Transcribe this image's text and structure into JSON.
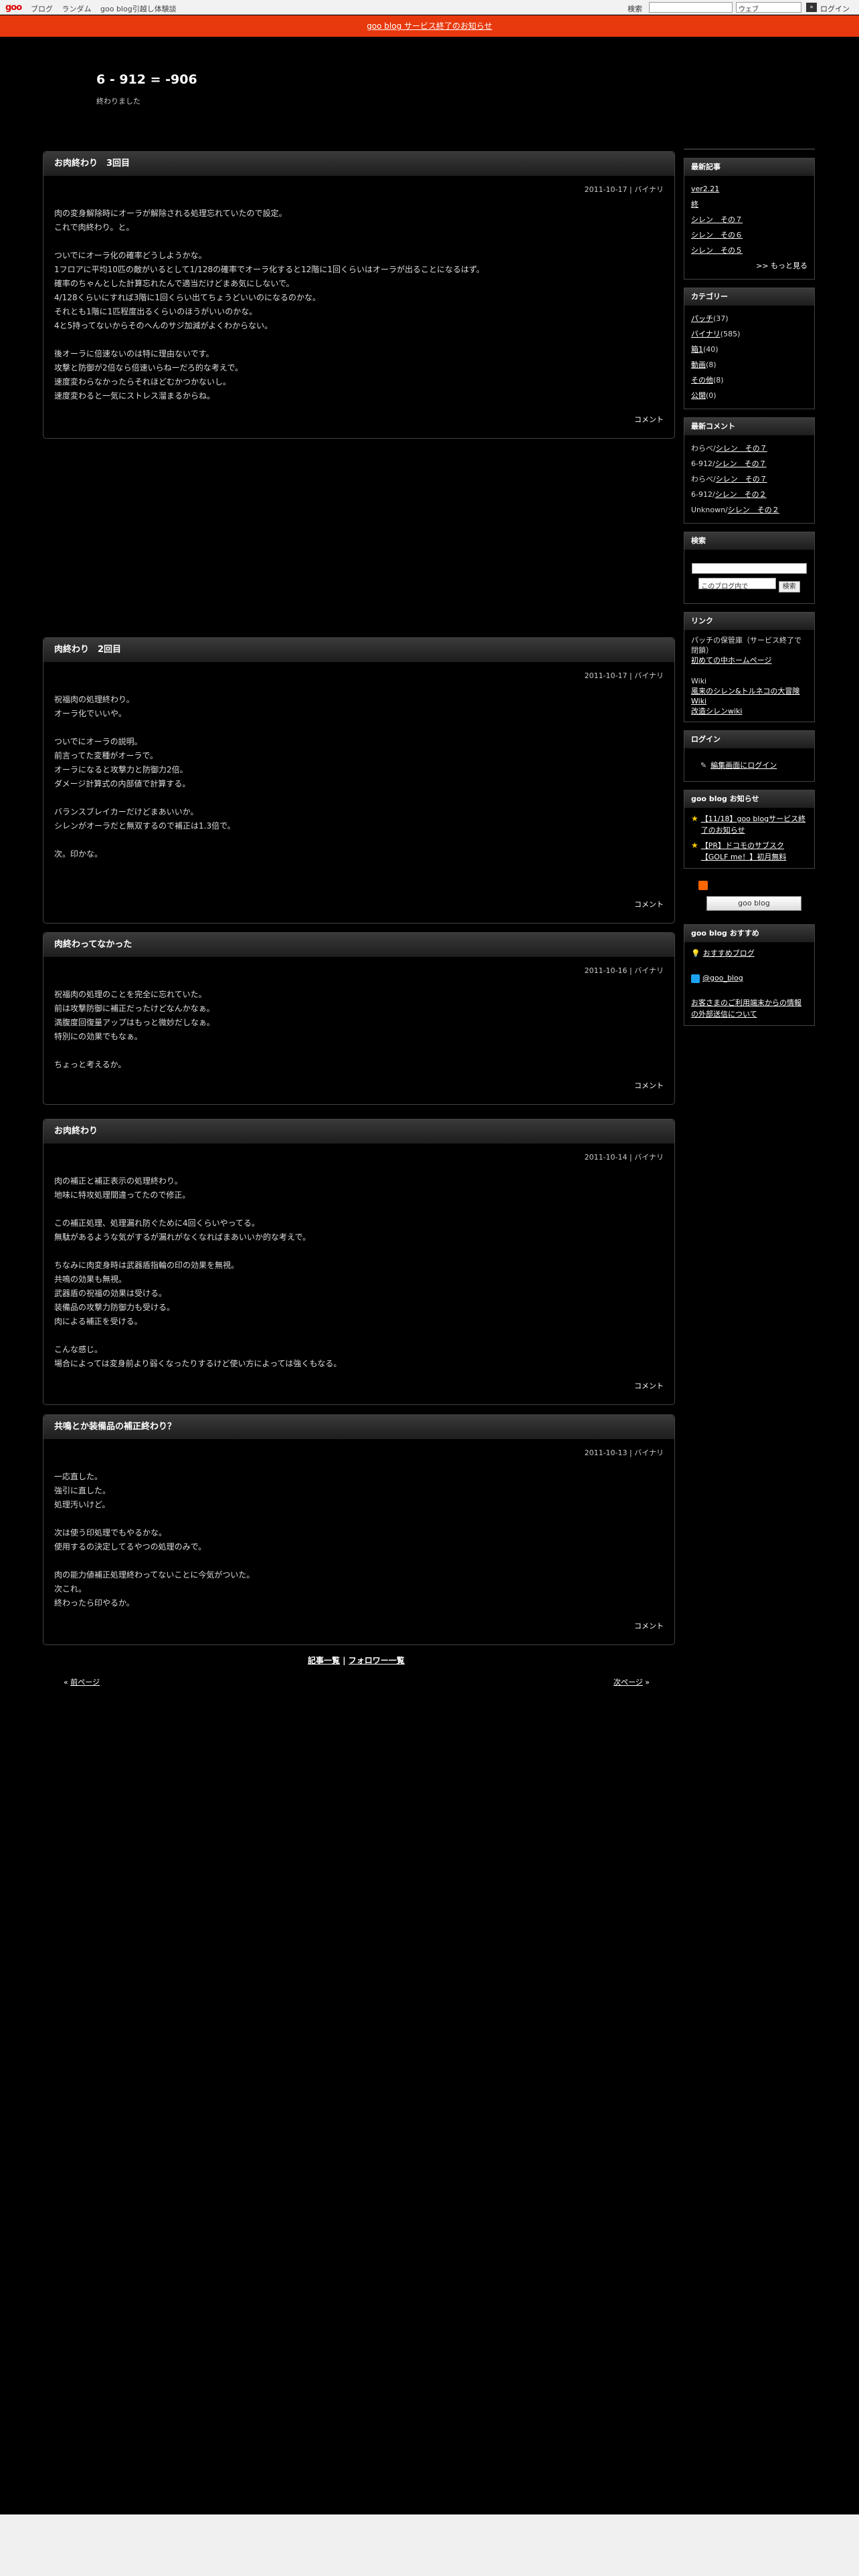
{
  "topbar": {
    "logo": "goo",
    "nav": [
      "ブログ",
      "ランダム",
      "goo blog引越し体験談"
    ],
    "search_label": "検索",
    "search_scope": "ウェブ",
    "go_button": "»",
    "login": "ログイン"
  },
  "notice": "goo blog サービス終了のお知らせ",
  "blog": {
    "title": "6 - 912 = -906",
    "description": "終わりました"
  },
  "entries": [
    {
      "title": "お肉終わり　3回目",
      "date": "2011-10-17",
      "category": "バイナリ",
      "body": [
        "肉の変身解除時にオーラが解除される処理忘れていたので設定。",
        "これで肉終わり。と。",
        "",
        "ついでにオーラ化の確率どうしようかな。",
        "1フロアに平均10匹の敵がいるとして1/128の確率でオーラ化すると12階に1回くらいはオーラが出ることになるはず。",
        "確率のちゃんとした計算忘れたんで適当だけどまあ気にしないで。",
        "4/128くらいにすれば3階に1回くらい出てちょうどいいのになるのかな。",
        "それとも1階に1匹程度出るくらいのほうがいいのかな。",
        "4と5持ってないからそのへんのサジ加減がよくわからない。",
        "",
        "後オーラに倍速ないのは特に理由ないです。",
        "攻撃と防御が2倍なら倍速いらねーだろ的な考えで。",
        "速度変わらなかったらそれほどむかつかないし。",
        "速度変わると一気にストレス溜まるからね。"
      ],
      "comment": "コメント"
    },
    {
      "title": "肉終わり　2回目",
      "date": "2011-10-17",
      "category": "バイナリ",
      "body": [
        "祝福肉の処理終わり。",
        "オーラ化でいいや。",
        "",
        "ついでにオーラの説明。",
        "前言ってた変種がオーラで。",
        "オーラになると攻撃力と防御力2倍。",
        "ダメージ計算式の内部値で計算する。",
        "",
        "バランスブレイカーだけどまあいいか。",
        "シレンがオーラだと無双するので補正は1.3倍で。",
        "",
        "次。印かな。"
      ],
      "comment": "コメント"
    },
    {
      "title": "肉終わってなかった",
      "date": "2011-10-16",
      "category": "バイナリ",
      "body": [
        "祝福肉の処理のことを完全に忘れていた。",
        "前は攻撃防御に補正だったけどなんかなぁ。",
        "満腹度回復量アップはもっと微妙だしなぁ。",
        "特別にの効果でもなぁ。",
        "",
        "ちょっと考えるか。"
      ],
      "comment": "コメント"
    },
    {
      "title": "お肉終わり",
      "date": "2011-10-14",
      "category": "バイナリ",
      "body": [
        "肉の補正と補正表示の処理終わり。",
        "地味に特攻処理間違ってたので修正。",
        "",
        "この補正処理、処理漏れ防ぐために4回くらいやってる。",
        "無駄があるような気がするが漏れがなくなればまあいいか的な考えで。",
        "",
        "ちなみに肉変身時は武器盾指輪の印の効果を無視。",
        "共鳴の効果も無視。",
        "武器盾の祝福の効果は受ける。",
        "装備品の攻撃力防御力も受ける。",
        "肉による補正を受ける。",
        "",
        "こんな感じ。",
        "場合によっては変身前より弱くなったりするけど使い方によっては強くもなる。"
      ],
      "comment": "コメント"
    },
    {
      "title": "共鳴とか装備品の補正終わり？",
      "date": "2011-10-13",
      "category": "バイナリ",
      "body": [
        "一応直した。",
        "強引に直した。",
        "処理汚いけど。",
        "",
        "次は使う印処理でもやるかな。",
        "使用するの決定してるやつの処理のみで。",
        "",
        "肉の能力値補正処理終わってないことに今気がついた。",
        "次これ。",
        "終わったら印やるか。"
      ],
      "comment": "コメント"
    }
  ],
  "sidebar": {
    "recent_title": "最新記事",
    "recent": [
      "ver2.21",
      "終",
      "シレン　その７",
      "シレン　その６",
      "シレン　その５"
    ],
    "more": ">> もっと見る",
    "category_title": "カテゴリー",
    "categories": [
      {
        "name": "パッチ",
        "count": "(37)"
      },
      {
        "name": "バイナリ",
        "count": "(585)"
      },
      {
        "name": "箱1",
        "count": "(40)"
      },
      {
        "name": "動画",
        "count": "(8)"
      },
      {
        "name": "その他",
        "count": "(8)"
      },
      {
        "name": "公開",
        "count": "(0)"
      }
    ],
    "comments_title": "最新コメント",
    "comments": [
      {
        "author": "わらべ",
        "post": "シレン　その７"
      },
      {
        "author": "6-912",
        "post": "シレン　その７"
      },
      {
        "author": "わらべ",
        "post": "シレン　その７"
      },
      {
        "author": "6-912",
        "post": "シレン　その２"
      },
      {
        "author": "Unknown",
        "post": "シレン　その２"
      }
    ],
    "search_title": "検索",
    "search_scope": "このブログ内で",
    "search_btn": "検索",
    "links_title": "リンク",
    "links_text1": "パッチの保管庫（サービス終了で閉鎖）",
    "links_link1": "初めての中ホームページ",
    "links_text2": "Wiki",
    "links_link2": "風来のシレン&トルネコの大冒険 Wiki",
    "links_link3": "改造シレンwiki",
    "login_title": "ログイン",
    "login_link": "編集画面にログイン",
    "news_title": "goo blog お知らせ",
    "news": [
      "【11/18】goo blogサービス終了のお知らせ",
      "【PR】ドコモのサブスク【GOLF me！】初月無料"
    ],
    "goo_btn": "goo blog",
    "rec_title": "goo blog おすすめ",
    "rec_link": "おすすめブログ",
    "twitter": "@goo_blog",
    "external": "お客さまのご利用端末からの情報の外部送信について"
  },
  "footer": {
    "list": "記事一覧",
    "sep": "|",
    "follow": "フォロワー一覧",
    "prev": "前ページ",
    "next": "次ページ"
  }
}
